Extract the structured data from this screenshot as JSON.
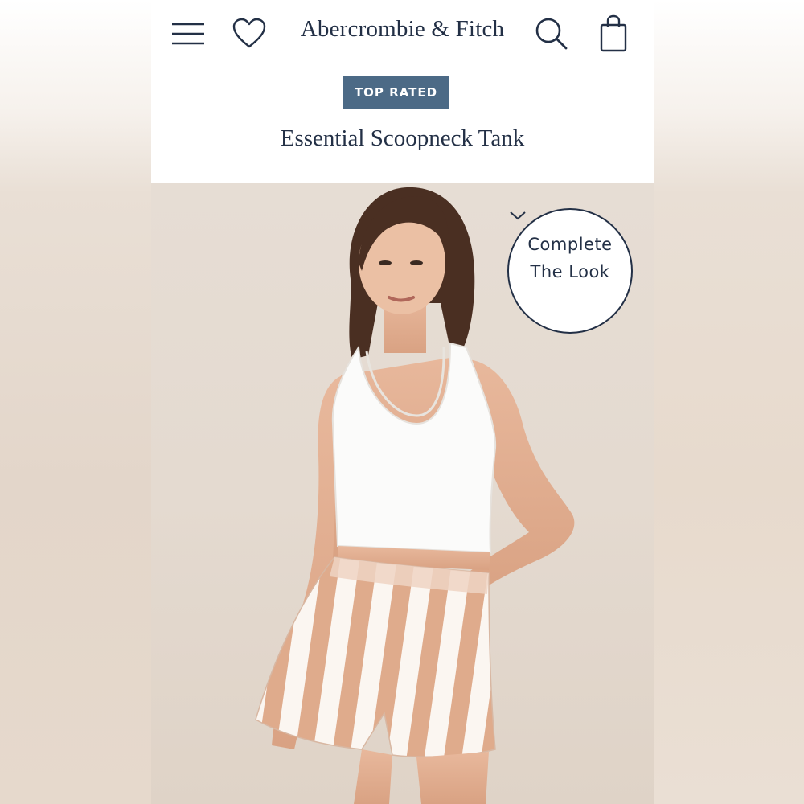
{
  "header": {
    "brand": "Abercrombie & Fitch",
    "icons": [
      "hamburger-menu-icon",
      "heart-icon",
      "search-icon",
      "shopping-bag-icon"
    ]
  },
  "product": {
    "badge": "TOP RATED",
    "title": "Essential Scoopneck Tank"
  },
  "complete_the_look": {
    "line1": "Complete",
    "line2": "The Look",
    "icon": "chevron-down-icon"
  },
  "colors": {
    "brand_navy": "#233046",
    "badge_blue": "#4c6a86",
    "photo_bg": "#e4dad0"
  }
}
